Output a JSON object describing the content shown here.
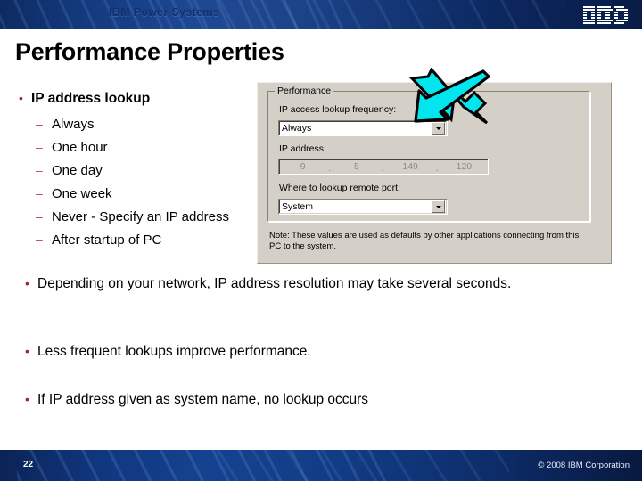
{
  "header": {
    "brand": "IBM Power Systems",
    "logo_alt": "IBM",
    "band_color": "#123a82"
  },
  "slide": {
    "title": "Performance Properties"
  },
  "content": {
    "bullets": [
      {
        "text": "IP address lookup",
        "bold": true,
        "sub": [
          "Always",
          "One hour",
          "One day",
          "One week",
          "Never - Specify an IP address",
          "After startup of PC"
        ]
      },
      {
        "text": " Depending on your network, IP address resolution may take several seconds.",
        "bold": false,
        "sub": []
      },
      {
        "text": "Less frequent lookups improve performance.",
        "bold": false,
        "sub": []
      },
      {
        "text": "If IP address given as system name, no lookup occurs",
        "bold": false,
        "sub": []
      }
    ],
    "bullet_color": "#9e2a2a",
    "dash_color": "#b05050"
  },
  "dialog": {
    "group_label": "Performance",
    "frequency_label": "IP access lookup frequency:",
    "frequency_value": "Always",
    "ip_label": "IP address:",
    "ip_octets": [
      "9",
      "5",
      "149",
      "120"
    ],
    "ip_separator": ".",
    "remote_port_label": "Where to lookup remote port:",
    "remote_port_value": "System",
    "note": "Note: These values are used as defaults by other applications connecting from this PC to the system.",
    "face_color": "#d4d0c8"
  },
  "annotation": {
    "arrow_name": "down-left-arrow",
    "fill_color": "#00e5ee",
    "outline_color": "#000000"
  },
  "footer": {
    "page_number": "22",
    "copyright": "© 2008 IBM Corporation"
  }
}
